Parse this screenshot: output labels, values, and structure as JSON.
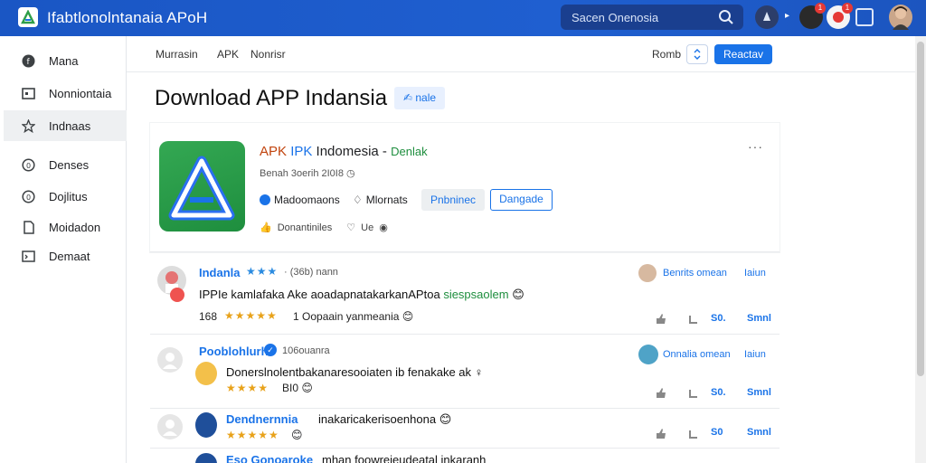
{
  "app": {
    "title": "Ifabtlonolntanaia APoH",
    "search_placeholder": "Sacen Onenosia"
  },
  "header": {
    "badges": [
      "1",
      "1"
    ]
  },
  "sidebar": {
    "items": [
      {
        "label": "Mana",
        "icon": "info-icon"
      },
      {
        "label": "Nonniontaia",
        "icon": "window-icon"
      },
      {
        "label": "Indnaas",
        "icon": "star-icon",
        "active": true
      },
      {
        "label": "Denses",
        "icon": "clock-icon"
      },
      {
        "label": "Dojlitus",
        "icon": "refresh-icon"
      },
      {
        "label": "Moidadon",
        "icon": "document-icon"
      },
      {
        "label": "Demaat",
        "icon": "terminal-icon"
      }
    ]
  },
  "subnav": {
    "links": [
      "Murrasin",
      "APK",
      "Nonrisr"
    ],
    "right_text": "Romb",
    "primary_button": "Reactav"
  },
  "page": {
    "title": "Download APP Indansia",
    "chip": "nale"
  },
  "app_card": {
    "name_parts": [
      "APK",
      "IPK",
      "Indomesia",
      "Denlak"
    ],
    "meta": "Benah 3oerih 2I0I8",
    "tag": "Madoomaons",
    "secondary": "Mlornats",
    "btn_gray": "Pnbninec",
    "btn_outline": "Dangade",
    "row3_text": "Donantiniles",
    "row3_heart": "Ue"
  },
  "reviews": [
    {
      "name": "Indanla",
      "time": "· (36b) nann",
      "text": "IPPIe kamlafaka Ake aoadapnatakarkanAPtoa",
      "text_highlight": "siespsaolem",
      "rating_count": "168",
      "sub_text": "1 Oopaain yanmeania",
      "right_user": "Benrits omean",
      "right_action": "Iaiun",
      "stat": "S0.",
      "stat2": "Smnl"
    },
    {
      "name": "Pooblohlurh",
      "time": "106ouanra",
      "text": "Donerslnolentbakanaresooiaten ib fenakake ak",
      "sub_text": "BI0",
      "right_user": "Onnalia omean",
      "right_action": "Iaiun",
      "stat": "S0.",
      "stat2": "Smnl"
    },
    {
      "name": "Dendnernnia",
      "text": "inakaricakerisoenhona",
      "stat": "S0",
      "stat2": "Smnl"
    },
    {
      "name": "Eso Gonoaroke",
      "text": "mhan foowreieudeatal inkaranh"
    }
  ],
  "colors": {
    "topbar": "#1f5fd0",
    "accent": "#1a73e8",
    "star": "#e8a21a",
    "app_icon": "#34a853"
  }
}
